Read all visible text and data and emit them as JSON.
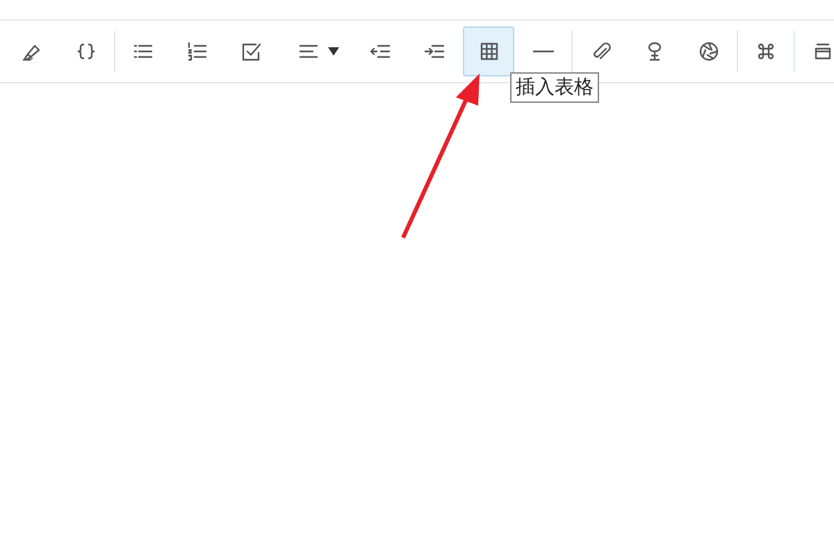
{
  "toolbar": {
    "groups": [
      {
        "buttons": [
          {
            "kind": "highlighter",
            "selected": false
          },
          {
            "kind": "code",
            "selected": false
          }
        ]
      },
      {
        "buttons": [
          {
            "kind": "bullet-list",
            "selected": false
          },
          {
            "kind": "numbered-list",
            "selected": false
          },
          {
            "kind": "task-list",
            "selected": false
          },
          {
            "kind": "align",
            "selected": false
          },
          {
            "kind": "outdent",
            "selected": false
          },
          {
            "kind": "indent",
            "selected": false
          },
          {
            "kind": "table",
            "selected": true
          },
          {
            "kind": "rule",
            "selected": false
          }
        ]
      },
      {
        "buttons": [
          {
            "kind": "paperclip",
            "selected": false
          },
          {
            "kind": "lamp",
            "selected": false
          },
          {
            "kind": "aperture",
            "selected": false
          }
        ]
      },
      {
        "buttons": [
          {
            "kind": "command",
            "selected": false
          }
        ]
      },
      {
        "buttons": [
          {
            "kind": "stack",
            "selected": false
          }
        ]
      }
    ]
  },
  "tooltip": {
    "text": "插入表格"
  }
}
